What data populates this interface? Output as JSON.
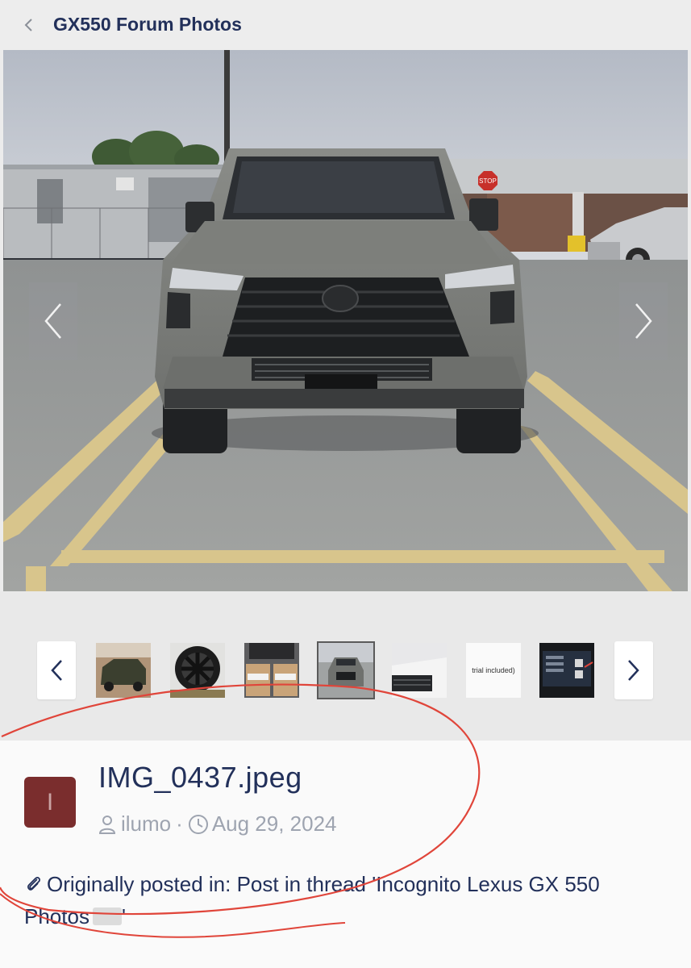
{
  "header": {
    "back_icon": "chevron-left-icon",
    "title": "GX550 Forum Photos"
  },
  "viewer": {
    "prev_icon": "chevron-left-icon",
    "next_icon": "chevron-right-icon",
    "image_text": {
      "stop_sign": "STOP"
    }
  },
  "filmstrip": {
    "prev_icon": "chevron-left-icon",
    "next_icon": "chevron-right-icon",
    "thumbnails": [
      {
        "kind": "suv-dark-green"
      },
      {
        "kind": "wheel"
      },
      {
        "kind": "boxes"
      },
      {
        "kind": "suv-front-grey",
        "active": true
      },
      {
        "kind": "suv-white-front"
      },
      {
        "kind": "text",
        "text": "trial included)"
      },
      {
        "kind": "screen"
      }
    ]
  },
  "media": {
    "avatar_letter": "I",
    "avatar_color": "#7a2d2d",
    "filename": "IMG_0437.jpeg",
    "user_icon": "user-icon",
    "author": "ilumo",
    "separator": "·",
    "clock_icon": "clock-icon",
    "date": "Aug 29, 2024",
    "paperclip_icon": "paperclip-icon",
    "posted_prefix": "Originally posted in:",
    "posted_link": "Post in thread 'Incognito Lexus GX 550 Photos",
    "posted_suffix": "'"
  },
  "annotation": {
    "color": "#e0453a"
  }
}
